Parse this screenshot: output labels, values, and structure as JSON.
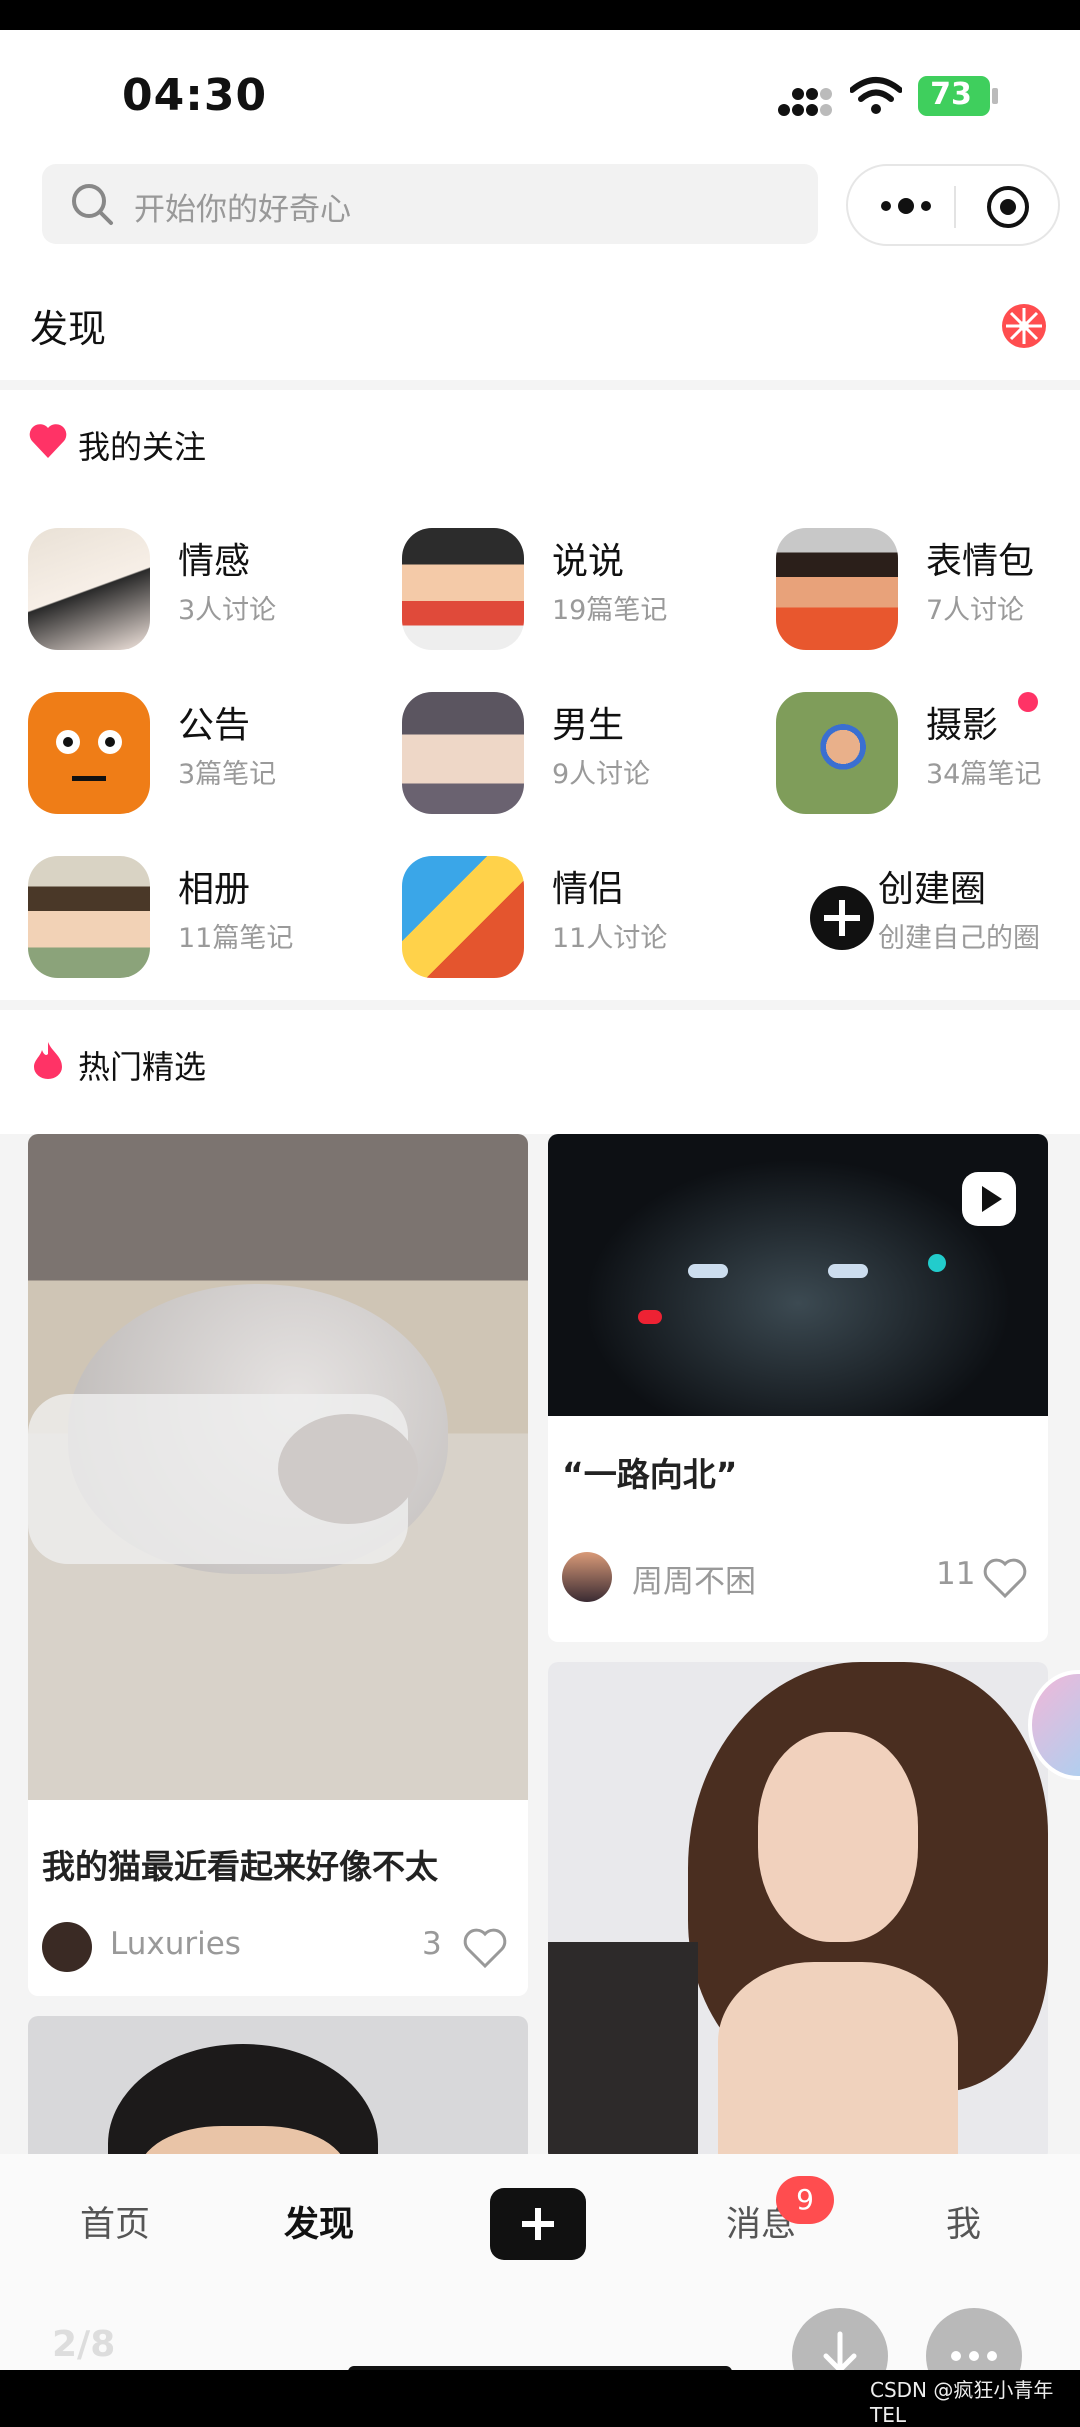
{
  "status": {
    "time": "04:30",
    "battery": "73"
  },
  "search": {
    "placeholder": "开始你的好奇心"
  },
  "header": {
    "title": "发现"
  },
  "follow": {
    "title": "我的关注",
    "circles": [
      {
        "name": "情感",
        "meta": "3人讨论"
      },
      {
        "name": "说说",
        "meta": "19篇笔记"
      },
      {
        "name": "表情包",
        "meta": "7人讨论"
      },
      {
        "name": "公告",
        "meta": "3篇笔记"
      },
      {
        "name": "男生",
        "meta": "9人讨论"
      },
      {
        "name": "摄影",
        "meta": "34篇笔记"
      },
      {
        "name": "相册",
        "meta": "11篇笔记"
      },
      {
        "name": "情侣",
        "meta": "11人讨论"
      },
      {
        "name": "创建圈",
        "meta": "创建自己的圈"
      }
    ]
  },
  "hot": {
    "title": "热门精选",
    "posts": [
      {
        "caption": "我的猫最近看起来好像不太",
        "author": "Luxuries",
        "likes": "3"
      },
      {
        "caption": "“一路向北”",
        "author": "周周不困",
        "likes": "11"
      }
    ]
  },
  "nav": {
    "tabs": [
      "首页",
      "发现",
      "消息",
      "我"
    ],
    "badge": "9",
    "pager": "2/8"
  },
  "colors": {
    "accent": "#ff3366",
    "badge": "#ff4d4f",
    "battery": "#3fcf5d"
  },
  "watermark": "CSDN @疯狂小青年TEL"
}
